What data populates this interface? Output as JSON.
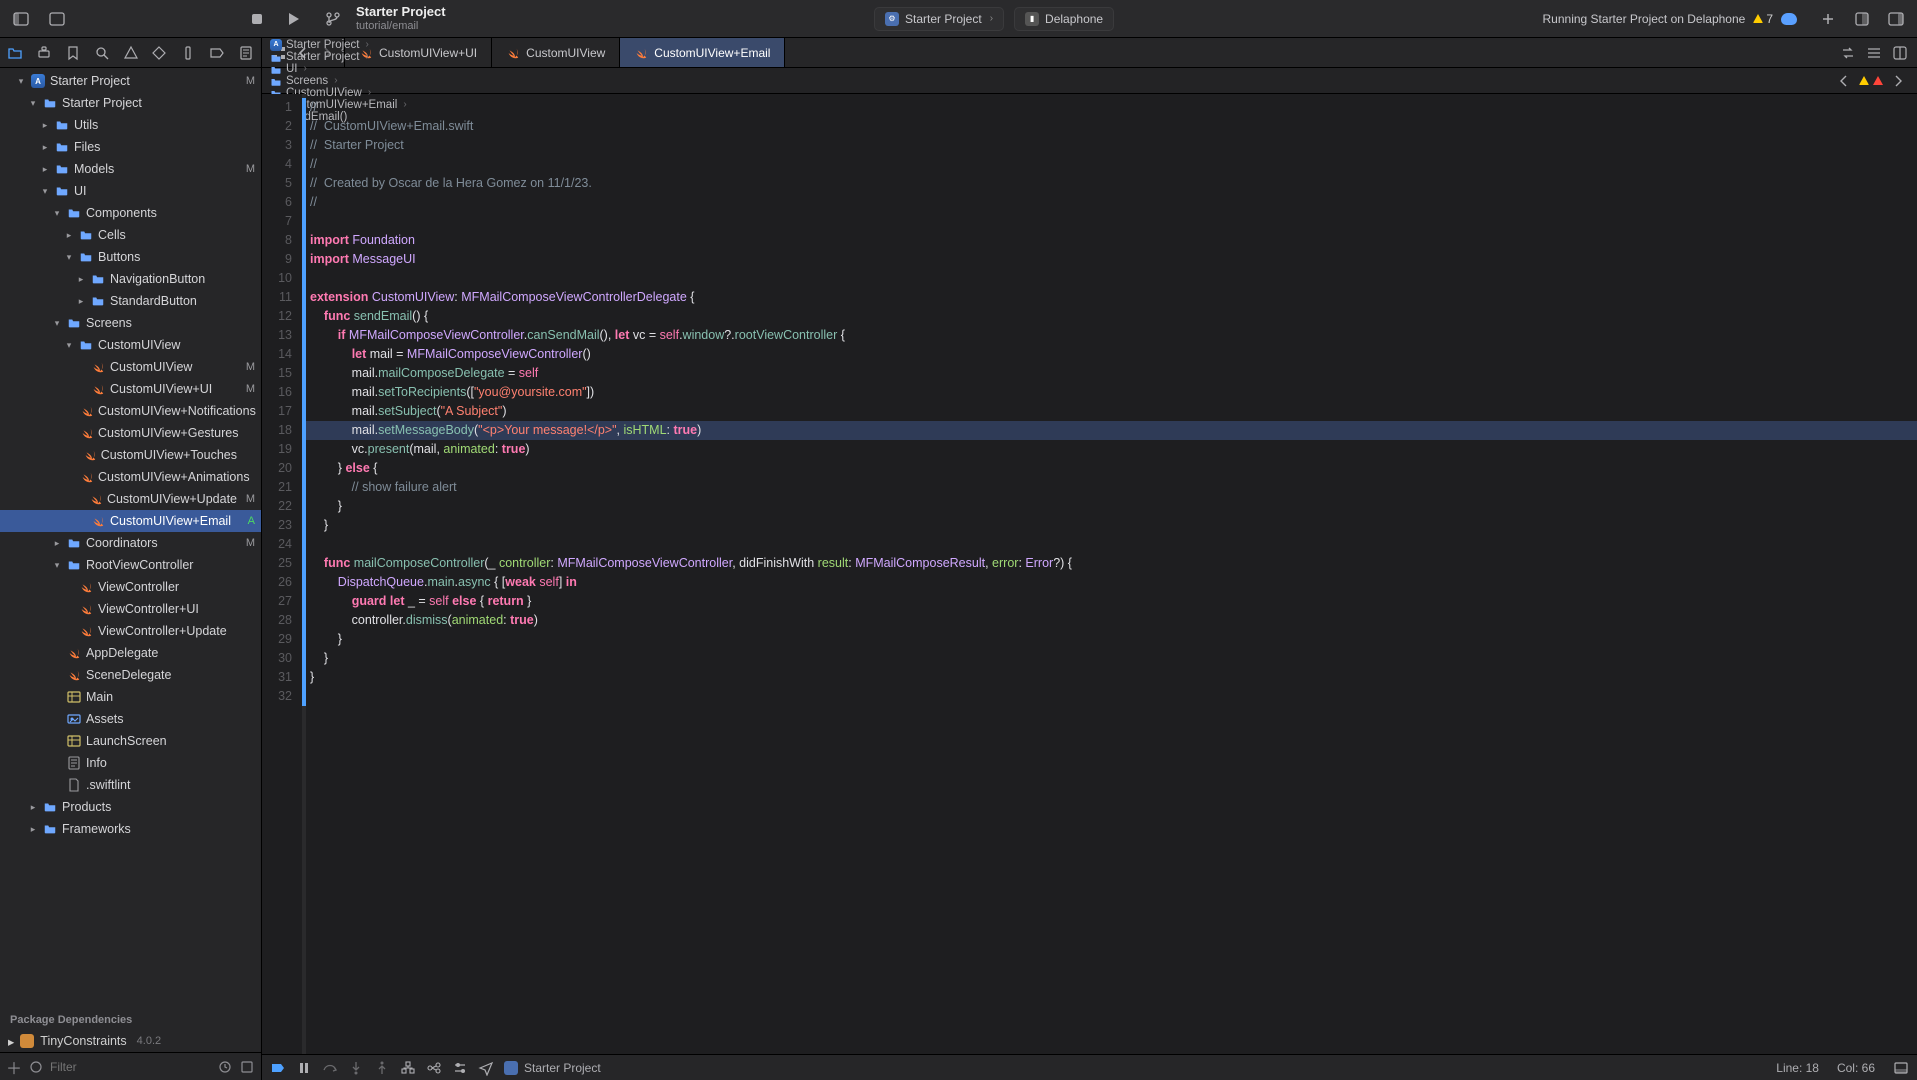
{
  "toolbar": {
    "title": "Starter Project",
    "subtitle": "tutorial/email",
    "scheme": "Starter Project",
    "device": "Delaphone",
    "status": "Running Starter Project on Delaphone",
    "warn_count": "7"
  },
  "tabs": [
    {
      "label": "CustomUIView+UI",
      "active": false
    },
    {
      "label": "CustomUIView",
      "active": false
    },
    {
      "label": "CustomUIView+Email",
      "active": true
    }
  ],
  "jump_bar": [
    "Starter Project",
    "Starter Project",
    "UI",
    "Screens",
    "CustomUIView",
    "CustomUIView+Email",
    "sendEmail()"
  ],
  "tree": {
    "root": "Starter Project",
    "root_badge": "M",
    "nodes": [
      {
        "d": 1,
        "t": "proj",
        "n": "Starter Project",
        "open": true,
        "b": "M"
      },
      {
        "d": 2,
        "t": "folder",
        "n": "Starter Project",
        "open": true
      },
      {
        "d": 3,
        "t": "folder",
        "n": "Utils",
        "open": false,
        "chev": ">"
      },
      {
        "d": 3,
        "t": "folder",
        "n": "Files",
        "open": false,
        "chev": ">"
      },
      {
        "d": 3,
        "t": "folder",
        "n": "Models",
        "open": false,
        "chev": ">",
        "b": "M"
      },
      {
        "d": 3,
        "t": "folder",
        "n": "UI",
        "open": true
      },
      {
        "d": 4,
        "t": "folder",
        "n": "Components",
        "open": true
      },
      {
        "d": 5,
        "t": "folder",
        "n": "Cells",
        "open": false,
        "chev": ">"
      },
      {
        "d": 5,
        "t": "folder",
        "n": "Buttons",
        "open": true
      },
      {
        "d": 6,
        "t": "folder",
        "n": "NavigationButton",
        "open": false,
        "chev": ">"
      },
      {
        "d": 6,
        "t": "folder",
        "n": "StandardButton",
        "open": false,
        "chev": ">"
      },
      {
        "d": 4,
        "t": "folder",
        "n": "Screens",
        "open": true
      },
      {
        "d": 5,
        "t": "folder",
        "n": "CustomUIView",
        "open": true
      },
      {
        "d": 6,
        "t": "swift",
        "n": "CustomUIView",
        "b": "M"
      },
      {
        "d": 6,
        "t": "swift",
        "n": "CustomUIView+UI",
        "b": "M"
      },
      {
        "d": 6,
        "t": "swift",
        "n": "CustomUIView+Notifications"
      },
      {
        "d": 6,
        "t": "swift",
        "n": "CustomUIView+Gestures"
      },
      {
        "d": 6,
        "t": "swift",
        "n": "CustomUIView+Touches"
      },
      {
        "d": 6,
        "t": "swift",
        "n": "CustomUIView+Animations"
      },
      {
        "d": 6,
        "t": "swift",
        "n": "CustomUIView+Update",
        "b": "M"
      },
      {
        "d": 6,
        "t": "swift",
        "n": "CustomUIView+Email",
        "b": "A",
        "sel": true
      },
      {
        "d": 4,
        "t": "folder",
        "n": "Coordinators",
        "open": false,
        "chev": ">",
        "b": "M"
      },
      {
        "d": 4,
        "t": "folder",
        "n": "RootViewController",
        "open": true
      },
      {
        "d": 5,
        "t": "swift",
        "n": "ViewController"
      },
      {
        "d": 5,
        "t": "swift",
        "n": "ViewController+UI"
      },
      {
        "d": 5,
        "t": "swift",
        "n": "ViewController+Update"
      },
      {
        "d": 4,
        "t": "swift",
        "n": "AppDelegate"
      },
      {
        "d": 4,
        "t": "swift",
        "n": "SceneDelegate"
      },
      {
        "d": 4,
        "t": "storyboard",
        "n": "Main"
      },
      {
        "d": 4,
        "t": "assets",
        "n": "Assets"
      },
      {
        "d": 4,
        "t": "storyboard",
        "n": "LaunchScreen"
      },
      {
        "d": 4,
        "t": "plist",
        "n": "Info"
      },
      {
        "d": 4,
        "t": "file",
        "n": ".swiftlint"
      },
      {
        "d": 2,
        "t": "folder",
        "n": "Products",
        "open": false,
        "chev": ">"
      },
      {
        "d": 2,
        "t": "folder",
        "n": "Frameworks",
        "open": false,
        "chev": ">"
      }
    ],
    "deps_header": "Package Dependencies",
    "deps": [
      {
        "n": "TinyConstraints",
        "v": "4.0.2"
      }
    ]
  },
  "filter_placeholder": "Filter",
  "code": {
    "highlight_line": 18,
    "lines": [
      "//",
      "//  CustomUIView+Email.swift",
      "//  Starter Project",
      "//",
      "//  Created by Oscar de la Hera Gomez on 11/1/23.",
      "//",
      "",
      "import Foundation",
      "import MessageUI",
      "",
      "extension CustomUIView: MFMailComposeViewControllerDelegate {",
      "    func sendEmail() {",
      "        if MFMailComposeViewController.canSendMail(), let vc = self.window?.rootViewController {",
      "            let mail = MFMailComposeViewController()",
      "            mail.mailComposeDelegate = self",
      "            mail.setToRecipients([\"you@yoursite.com\"])",
      "            mail.setSubject(\"A Subject\")",
      "            mail.setMessageBody(\"<p>Your message!</p>\", isHTML: true)",
      "            vc.present(mail, animated: true)",
      "        } else {",
      "            // show failure alert",
      "        }",
      "    }",
      "",
      "    func mailComposeController(_ controller: MFMailComposeViewController, didFinishWith result: MFMailComposeResult, error: Error?) {",
      "        DispatchQueue.main.async { [weak self] in",
      "            guard let _ = self else { return }",
      "            controller.dismiss(animated: true)",
      "        }",
      "    }",
      "}",
      ""
    ]
  },
  "debug": {
    "scheme": "Starter Project",
    "status_line": "Line: 18",
    "status_col": "Col: 66"
  }
}
